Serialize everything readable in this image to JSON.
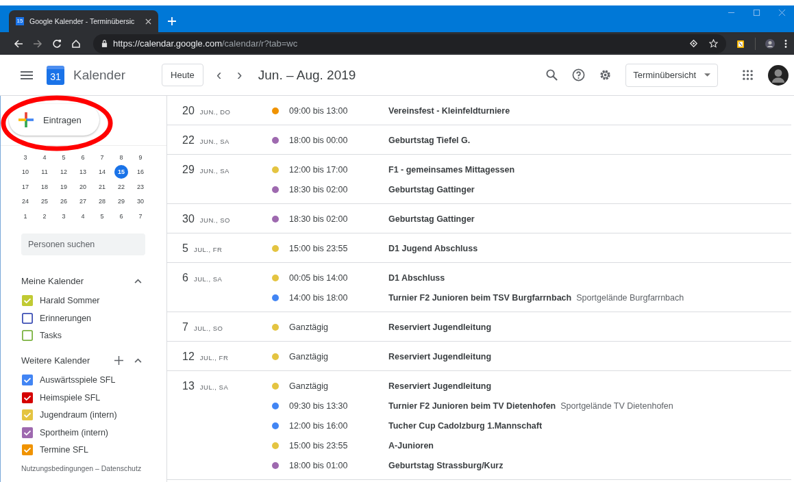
{
  "browser": {
    "tab": {
      "icon_text": "15",
      "title": "Google Kalender - Terminübersic",
      "selected": true
    },
    "url_host": "https://calendar.google.com",
    "url_path": "/calendar/r?tab=wc"
  },
  "header": {
    "app_icon_text": "31",
    "app_name": "Kalender",
    "today_button": "Heute",
    "prev": "‹",
    "next": "›",
    "date_range": "Jun. – Aug. 2019",
    "view_select": "Terminübersicht"
  },
  "sidebar": {
    "create_button": "Eintragen",
    "mini_calendar": [
      [
        {
          "day": "3",
          "selected": false
        },
        {
          "day": "4",
          "selected": false
        },
        {
          "day": "5",
          "selected": false
        },
        {
          "day": "6",
          "selected": false
        },
        {
          "day": "7",
          "selected": false
        },
        {
          "day": "8",
          "selected": false
        },
        {
          "day": "9",
          "selected": false
        }
      ],
      [
        {
          "day": "10",
          "selected": false
        },
        {
          "day": "11",
          "selected": false
        },
        {
          "day": "12",
          "selected": false
        },
        {
          "day": "13",
          "selected": false
        },
        {
          "day": "14",
          "selected": false
        },
        {
          "day": "15",
          "selected": true
        },
        {
          "day": "16",
          "selected": false
        }
      ],
      [
        {
          "day": "17",
          "selected": false
        },
        {
          "day": "18",
          "selected": false
        },
        {
          "day": "19",
          "selected": false
        },
        {
          "day": "20",
          "selected": false
        },
        {
          "day": "21",
          "selected": false
        },
        {
          "day": "22",
          "selected": false
        },
        {
          "day": "23",
          "selected": false
        }
      ],
      [
        {
          "day": "24",
          "selected": false
        },
        {
          "day": "25",
          "selected": false
        },
        {
          "day": "26",
          "selected": false
        },
        {
          "day": "27",
          "selected": false
        },
        {
          "day": "28",
          "selected": false
        },
        {
          "day": "29",
          "selected": false
        },
        {
          "day": "30",
          "selected": false
        }
      ],
      [
        {
          "day": "1",
          "selected": false
        },
        {
          "day": "2",
          "selected": false
        },
        {
          "day": "3",
          "selected": false
        },
        {
          "day": "4",
          "selected": false
        },
        {
          "day": "5",
          "selected": false
        },
        {
          "day": "6",
          "selected": false
        },
        {
          "day": "7",
          "selected": false
        }
      ]
    ],
    "people_search": {
      "placeholder": "Personen suchen"
    },
    "sections": [
      {
        "title": "Meine Kalender",
        "expanded": true,
        "calendars": [
          {
            "name": "Harald Sommer",
            "checked": true,
            "color": "#c0ca33"
          },
          {
            "name": "Erinnerungen",
            "checked": false,
            "color": "#3f51b5"
          },
          {
            "name": "Tasks",
            "checked": false,
            "color": "#7cb342"
          }
        ]
      },
      {
        "title": "Weitere Kalender",
        "expanded": true,
        "can_add": true,
        "calendars": [
          {
            "name": "Auswärtsspiele SFL",
            "checked": true,
            "color": "#4285f4"
          },
          {
            "name": "Heimspiele SFL",
            "checked": true,
            "color": "#d50000"
          },
          {
            "name": "Jugendraum (intern)",
            "checked": true,
            "color": "#e4c441"
          },
          {
            "name": "Sportheim (intern)",
            "checked": true,
            "color": "#9e69af"
          },
          {
            "name": "Termine SFL",
            "checked": true,
            "color": "#f09300"
          }
        ]
      }
    ],
    "footer": "Nutzungsbedingungen – Datenschutz"
  },
  "agenda": [
    {
      "day": "20",
      "label": "JUN., DO",
      "events": [
        {
          "time": "09:00 bis 13:00",
          "title": "Vereinsfest - Kleinfeldturniere",
          "color": "#f09300"
        }
      ]
    },
    {
      "day": "22",
      "label": "JUN., SA",
      "events": [
        {
          "time": "18:00 bis 00:00",
          "title": "Geburtstag Tiefel G.",
          "color": "#9e69af"
        }
      ]
    },
    {
      "day": "29",
      "label": "JUN., SA",
      "events": [
        {
          "time": "12:00 bis 17:00",
          "title": "F1 - gemeinsames Mittagessen",
          "color": "#e4c441"
        },
        {
          "time": "18:30 bis 02:00",
          "title": "Geburtstag Gattinger",
          "color": "#9e69af"
        }
      ]
    },
    {
      "day": "30",
      "label": "JUN., SO",
      "events": [
        {
          "time": "18:30 bis 02:00",
          "title": "Geburtstag Gattinger",
          "color": "#9e69af"
        }
      ]
    },
    {
      "day": "5",
      "label": "JUL., FR",
      "events": [
        {
          "time": "15:00 bis 23:55",
          "title": "D1 Jugend Abschluss",
          "color": "#e4c441"
        }
      ]
    },
    {
      "day": "6",
      "label": "JUL., SA",
      "events": [
        {
          "time": "00:05 bis 14:00",
          "title": "D1 Abschluss",
          "color": "#e4c441"
        },
        {
          "time": "14:00 bis 18:00",
          "title": "Turnier F2 Junioren beim TSV Burgfarrnbach",
          "location": "Sportgelände Burgfarrnbach",
          "color": "#4285f4"
        }
      ]
    },
    {
      "day": "7",
      "label": "JUL., SO",
      "events": [
        {
          "time": "Ganztägig",
          "title": "Reserviert Jugendleitung",
          "color": "#e4c441"
        }
      ]
    },
    {
      "day": "12",
      "label": "JUL., FR",
      "events": [
        {
          "time": "Ganztägig",
          "title": "Reserviert Jugendleitung",
          "color": "#e4c441"
        }
      ]
    },
    {
      "day": "13",
      "label": "JUL., SA",
      "events": [
        {
          "time": "Ganztägig",
          "title": "Reserviert Jugendleitung",
          "color": "#e4c441"
        },
        {
          "time": "09:30 bis 13:30",
          "title": "Turnier F2 Junioren beim TV Dietenhofen",
          "location": "Sportgelände TV Dietenhofen",
          "color": "#4285f4"
        },
        {
          "time": "12:00 bis 16:00",
          "title": "Tucher Cup Cadolzburg 1.Mannschaft",
          "color": "#4285f4"
        },
        {
          "time": "15:00 bis 23:55",
          "title": "A-Junioren",
          "color": "#e4c441"
        },
        {
          "time": "18:00 bis 01:00",
          "title": "Geburtstag Strassburg/Kurz",
          "color": "#9e69af"
        }
      ]
    }
  ]
}
